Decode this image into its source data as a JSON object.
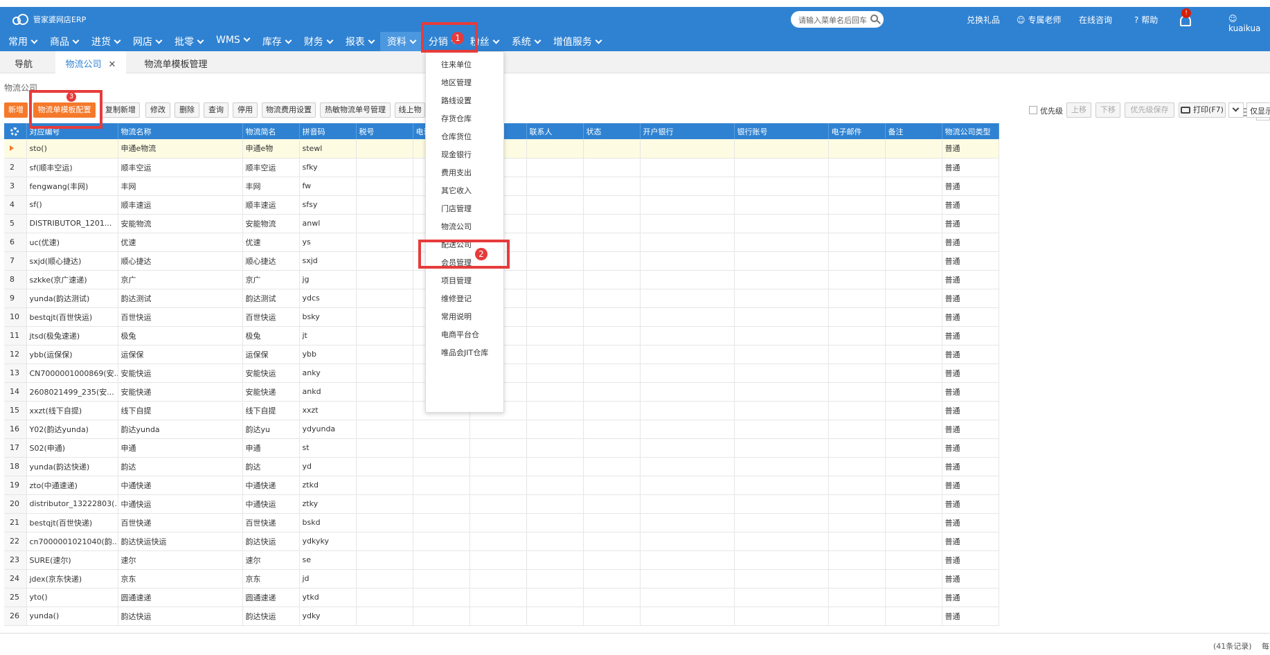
{
  "app": {
    "title": "管家婆网店ERP",
    "search_placeholder": "请输入菜单名后回车"
  },
  "top_links": {
    "gift": "兑换礼品",
    "teacher": "专属老师",
    "consult": "在线咨询",
    "help": "帮助",
    "bell_badge": "!",
    "user": "kuaikua"
  },
  "menu": [
    "常用",
    "商品",
    "进货",
    "网店",
    "批零",
    "WMS",
    "库存",
    "财务",
    "报表",
    "资料",
    "分销",
    "粉丝",
    "系统",
    "增值服务"
  ],
  "tabs": {
    "nav": "导航",
    "logistics": "物流公司",
    "template": "物流单模板管理",
    "close": "✕",
    "right_icon_text": "自"
  },
  "breadcrumb": "物流公司",
  "toolbar": {
    "add": "新增",
    "template_config": "物流单模板配置",
    "copy_add": "复制新增",
    "edit": "修改",
    "delete": "删除",
    "query": "查询",
    "disable": "停用",
    "fee_setting": "物流费用设置",
    "hot_number": "热敏物流单号管理",
    "online": "线上物",
    "priority": "优先级",
    "up": "上移",
    "down": "下移",
    "priority_save": "优先级保存",
    "print": "打印(F7)",
    "show_only": "仅显示"
  },
  "grid": {
    "columns": [
      "对应编号",
      "物流名称",
      "物流简名",
      "拼音码",
      "税号",
      "电话",
      "",
      "联系人",
      "状态",
      "开户银行",
      "银行账号",
      "电子邮件",
      "备注",
      "物流公司类型"
    ],
    "rows": [
      [
        "▶",
        "sto()",
        "申通e物流",
        "申通e物",
        "stewl",
        "普通"
      ],
      [
        "2",
        "sf(顺丰空运)",
        "顺丰空运",
        "顺丰空运",
        "sfky",
        "普通"
      ],
      [
        "3",
        "fengwang(丰网)",
        "丰网",
        "丰网",
        "fw",
        "普通"
      ],
      [
        "4",
        "sf()",
        "顺丰速运",
        "顺丰速运",
        "sfsy",
        "普通"
      ],
      [
        "5",
        "DISTRIBUTOR_1201...",
        "安能物流",
        "安能物流",
        "anwl",
        "普通"
      ],
      [
        "6",
        "uc(优速)",
        "优速",
        "优速",
        "ys",
        "普通"
      ],
      [
        "7",
        "sxjd(顺心捷达)",
        "顺心捷达",
        "顺心捷达",
        "sxjd",
        "普通"
      ],
      [
        "8",
        "szkke(京广速递)",
        "京广",
        "京广",
        "jg",
        "普通"
      ],
      [
        "9",
        "yunda(韵达测试)",
        "韵达测试",
        "韵达测试",
        "ydcs",
        "普通"
      ],
      [
        "10",
        "bestqjt(百世快运)",
        "百世快运",
        "百世快运",
        "bsky",
        "普通"
      ],
      [
        "11",
        "jtsd(极兔速递)",
        "极兔",
        "极兔",
        "jt",
        "普通"
      ],
      [
        "12",
        "ybb(运保保)",
        "运保保",
        "运保保",
        "ybb",
        "普通"
      ],
      [
        "13",
        "CN7000001000869(安...",
        "安能快运",
        "安能快运",
        "anky",
        "普通"
      ],
      [
        "14",
        "2608021499_235(安...",
        "安能快递",
        "安能快递",
        "ankd",
        "普通"
      ],
      [
        "15",
        "xxzt(线下自提)",
        "线下自提",
        "线下自提",
        "xxzt",
        "普通"
      ],
      [
        "16",
        "Y02(韵达yunda)",
        "韵达yunda",
        "韵达yu",
        "ydyunda",
        "普通"
      ],
      [
        "17",
        "S02(申通)",
        "申通",
        "申通",
        "st",
        "普通"
      ],
      [
        "18",
        "yunda(韵达快递)",
        "韵达",
        "韵达",
        "yd",
        "普通"
      ],
      [
        "19",
        "zto(中通速递)",
        "中通快递",
        "中通快递",
        "ztkd",
        "普通"
      ],
      [
        "20",
        "distributor_13222803(...",
        "中通快运",
        "中通快运",
        "ztky",
        "普通"
      ],
      [
        "21",
        "bestqjt(百世快递)",
        "百世快递",
        "百世快递",
        "bskd",
        "普通"
      ],
      [
        "22",
        "cn7000001021040(韵...",
        "韵达快运快运",
        "韵达快运",
        "ydkyky",
        "普通"
      ],
      [
        "23",
        "SURE(速尔)",
        "速尔",
        "速尔",
        "se",
        "普通"
      ],
      [
        "24",
        "jdex(京东快递)",
        "京东",
        "京东",
        "jd",
        "普通"
      ],
      [
        "25",
        "yto()",
        "圆通速递",
        "圆通速递",
        "ytkd",
        "普通"
      ],
      [
        "26",
        "yunda()",
        "韵达快运",
        "韵达快运",
        "ydky",
        "普通"
      ]
    ]
  },
  "dropdown": [
    "往来单位",
    "地区管理",
    "路线设置",
    "存货仓库",
    "仓库货位",
    "现金银行",
    "费用支出",
    "其它收入",
    "门店管理",
    "物流公司",
    "配送公司",
    "会员管理",
    "项目管理",
    "维修登记",
    "常用说明",
    "电商平台仓",
    "唯品会JIT仓库"
  ],
  "badges": {
    "one": "1",
    "two": "2",
    "three": "3"
  },
  "status": {
    "records": "(41条记录)",
    "per_page": "每"
  },
  "colors": {
    "header_blue": "#2f82d2",
    "accent_orange": "#f5792a",
    "highlight_red": "#e63b3b"
  }
}
